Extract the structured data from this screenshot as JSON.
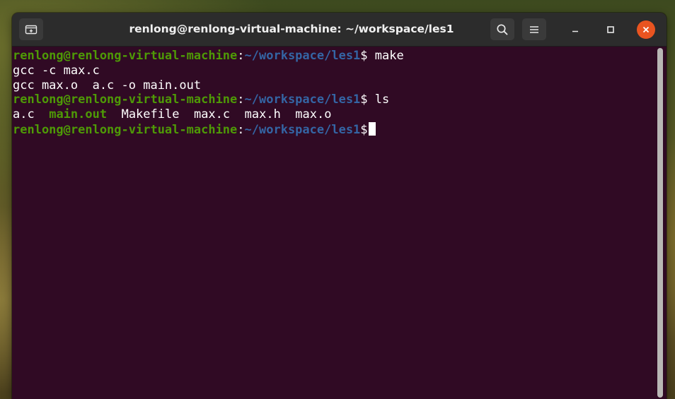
{
  "window": {
    "title": "renlong@renlong-virtual-machine: ~/workspace/les1"
  },
  "colors": {
    "terminal_bg": "#300a24",
    "prompt_user": "#4e9a06",
    "prompt_path": "#3465a4",
    "close_button": "#e95420"
  },
  "icons": {
    "new_tab": "new-tab-icon",
    "search": "search-icon",
    "menu": "hamburger-menu-icon",
    "minimize": "minimize-icon",
    "maximize": "maximize-icon",
    "close": "close-icon"
  },
  "prompt": {
    "user_host": "renlong@renlong-virtual-machine",
    "colon": ":",
    "path": "~/workspace/les1",
    "symbol": "$"
  },
  "terminal": {
    "line1_command": " make",
    "line2_output": "gcc -c max.c",
    "line3_output": "gcc max.o  a.c -o main.out",
    "line4_command": " ls",
    "line5_files": {
      "f1": "a.c",
      "f2": "main.out",
      "f3": "Makefile",
      "f4": "max.c",
      "f5": "max.h",
      "f6": "max.o"
    }
  }
}
